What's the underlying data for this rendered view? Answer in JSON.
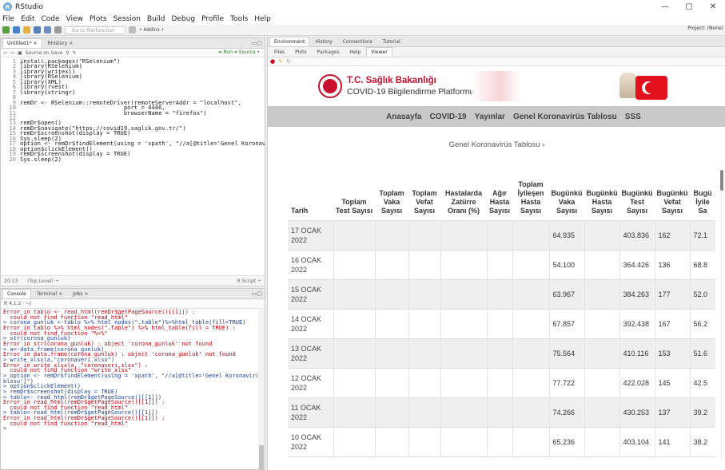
{
  "window": {
    "title": "RStudio",
    "min": "—",
    "max": "▢",
    "close": "✕"
  },
  "menu": [
    "File",
    "Edit",
    "Code",
    "View",
    "Plots",
    "Session",
    "Build",
    "Debug",
    "Profile",
    "Tools",
    "Help"
  ],
  "toolbar": {
    "goto_placeholder": "Go to file/function",
    "addins": "• Addins •",
    "project": "Project: (None)"
  },
  "editor": {
    "tabs": [
      "Untitled1* ×",
      "Rhistory ×"
    ],
    "toolbar_items": {
      "source_on_save": "Source on Save",
      "run": "➜ Run",
      "source": "➜ Source •"
    },
    "lines": [
      {
        "n": "1",
        "t": "install.packages(\"RSelenium\")"
      },
      {
        "n": "2",
        "t": "library(RSelenium)"
      },
      {
        "n": "3",
        "t": "library(writexl)"
      },
      {
        "n": "4",
        "t": "library(RSelenium)"
      },
      {
        "n": "5",
        "t": "library(XML)"
      },
      {
        "n": "6",
        "t": "library(rvest)"
      },
      {
        "n": "7",
        "t": "library(stringr)"
      },
      {
        "n": "8",
        "t": ""
      },
      {
        "n": "9",
        "t": "remDr <- RSelenium::remoteDriver(remoteServerAddr = \"localhost\","
      },
      {
        "n": "10",
        "t": "                              port = 4446,"
      },
      {
        "n": "11",
        "t": "                              browserName = \"firefox\")"
      },
      {
        "n": "12",
        "t": ""
      },
      {
        "n": "13",
        "t": "remDr$open()"
      },
      {
        "n": "14",
        "t": "remDr$navigate(\"https://covid19.saglik.gov.tr/\")"
      },
      {
        "n": "15",
        "t": "remDr$screenshot(display = TRUE)"
      },
      {
        "n": "16",
        "t": "Sys.sleep(2)"
      },
      {
        "n": "17",
        "t": "option <- remDr$findElement(using = 'xpath', \"//a[@title='Genel Koronavirüs"
      },
      {
        "n": "18",
        "t": "option$clickElement()"
      },
      {
        "n": "19",
        "t": "remDr$screenshot(display = TRUE)"
      },
      {
        "n": "20",
        "t": "Sys.sleep(2)"
      }
    ],
    "status_pos": "20:13",
    "status_scope": "(Top Level) ÷",
    "status_type": "R Script ÷"
  },
  "console": {
    "tabs": [
      "Console",
      "Terminal ×",
      "Jobs ×"
    ],
    "version": "R 4.1.2 · ~/",
    "lines": [
      {
        "k": "err",
        "t": "Error in tablo <- read_html(remDr$getPageSource()[[1]]) :"
      },
      {
        "k": "err",
        "t": "  could not find function \"read_html\""
      },
      {
        "k": "in",
        "t": "> corona_gunluk <-tablo %>% html_nodes(\".table\")%>%html_table(fill=TRUE)"
      },
      {
        "k": "err",
        "t": "Error in tablo %>% html_nodes(\".table\") %>% html_table(fill = TRUE) :"
      },
      {
        "k": "err",
        "t": "  could not find function \"%>%\""
      },
      {
        "k": "in",
        "t": "> str(corona_gunluk)"
      },
      {
        "k": "err",
        "t": "Error in str(corona_gunluk) : object 'corona_gunluk' not found"
      },
      {
        "k": "in",
        "t": "> a<-data.frame(corona_gunluk)"
      },
      {
        "k": "err",
        "t": "Error in data.frame(corona_gunluk) : object 'corona_gunluk' not found"
      },
      {
        "k": "in",
        "t": "> write_xlsx(a,\"coronaveri.xlsx\")"
      },
      {
        "k": "err",
        "t": "Error in write_xlsx(a, \"coronaveri.xlsx\") :"
      },
      {
        "k": "err",
        "t": "  could not find function \"write_xlsx\""
      },
      {
        "k": "in",
        "t": "> option <- remDr$findElement(using = 'xpath', \"//a[@title='Genel Koronavirüs Ta"
      },
      {
        "k": "in",
        "t": "blosu']\")"
      },
      {
        "k": "in",
        "t": "> option$clickElement()"
      },
      {
        "k": "in",
        "t": "> remDr$screenshot(display = TRUE)"
      },
      {
        "k": "in",
        "t": "> tablo<- read_html(remDr$getPageSource()[[1]])"
      },
      {
        "k": "err",
        "t": "Error in read_html(remDr$getPageSource()[[1]]) :"
      },
      {
        "k": "err",
        "t": "  could not find function \"read_html\""
      },
      {
        "k": "in",
        "t": "> tablo<-read_html(remDr$getPageSource()[[1]])"
      },
      {
        "k": "err",
        "t": "Error in read_html(remDr$getPageSource()[[1]]) :"
      },
      {
        "k": "err",
        "t": "  could not find function \"read_html\""
      },
      {
        "k": "in",
        "t": "> "
      }
    ]
  },
  "right_pane": {
    "top_tabs": [
      "Environment",
      "History",
      "Connections",
      "Tutorial"
    ],
    "bottom_tabs": [
      "Files",
      "Plots",
      "Packages",
      "Help",
      "Viewer"
    ]
  },
  "site": {
    "brand_line1": "T.C. Sağlık Bakanlığı",
    "brand_line2": "COVID-19 Bilgilendirme Platformu",
    "nav": [
      "Anasayfa",
      "COVID-19",
      "Yayınlar",
      "Genel Koronavirüs Tablosu",
      "SSS"
    ],
    "breadcrumb": "Genel Koronavirüs Tablosu ›",
    "colors": {
      "brand_red": "#c8102e",
      "nav_bg": "#c9c9c9"
    }
  },
  "table": {
    "headers": [
      "Tarih",
      "Toplam Test Sayısı",
      "Toplam Vaka Sayısı",
      "Toplam Vefat Sayısı",
      "Hastalarda Zatürre Oranı (%)",
      "Ağır Hasta Sayısı",
      "Toplam İyileşen Hasta Sayısı",
      "Bugünkü Vaka Sayısı",
      "Bugünkü Hasta Sayısı",
      "Bugünkü Test Sayısı",
      "Bugünkü Vefat Sayısı",
      "Bugü İyile Sa"
    ],
    "rows": [
      {
        "date1": "17 OCAK",
        "date2": "2022",
        "vaka": "64.935",
        "test": "403.836",
        "vefat": "162",
        "iyi": "72.1"
      },
      {
        "date1": "16 OCAK",
        "date2": "2022",
        "vaka": "54.100",
        "test": "364.426",
        "vefat": "136",
        "iyi": "68.8"
      },
      {
        "date1": "15 OCAK",
        "date2": "2022",
        "vaka": "63.967",
        "test": "384.263",
        "vefat": "177",
        "iyi": "52.0"
      },
      {
        "date1": "14 OCAK",
        "date2": "2022",
        "vaka": "67.857",
        "test": "392.438",
        "vefat": "167",
        "iyi": "56.2"
      },
      {
        "date1": "13 OCAK",
        "date2": "2022",
        "vaka": "75.564",
        "test": "410.116",
        "vefat": "153",
        "iyi": "51.6"
      },
      {
        "date1": "12 OCAK",
        "date2": "2022",
        "vaka": "77.722",
        "test": "422.028",
        "vefat": "145",
        "iyi": "42.5"
      },
      {
        "date1": "11 OCAK",
        "date2": "2022",
        "vaka": "74.266",
        "test": "430.253",
        "vefat": "137",
        "iyi": "39.2"
      },
      {
        "date1": "10 OCAK",
        "date2": "2022",
        "vaka": "65.236",
        "test": "403.104",
        "vefat": "141",
        "iyi": "38.2"
      }
    ]
  }
}
